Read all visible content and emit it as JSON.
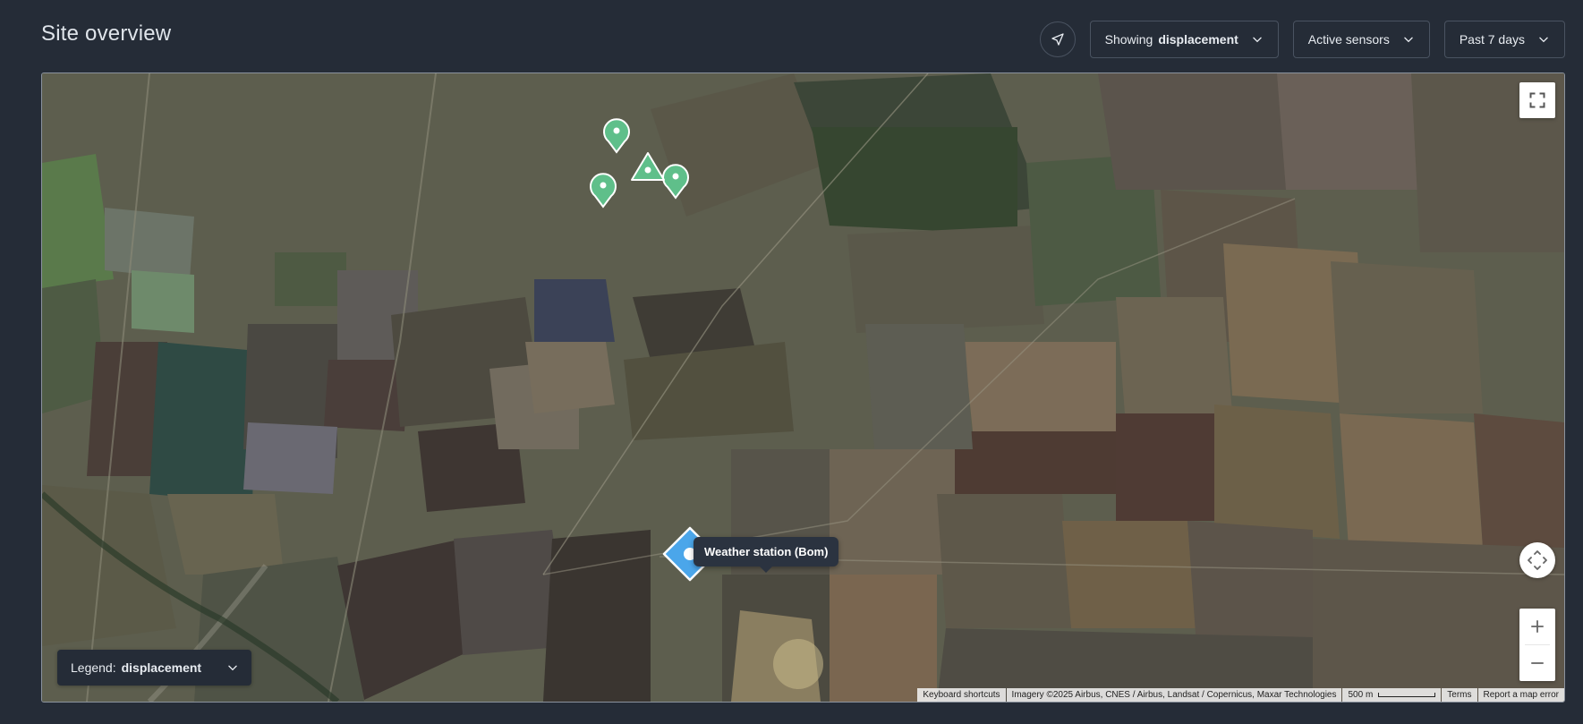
{
  "header": {
    "title": "Site overview"
  },
  "toolbar": {
    "location_icon": "navigation-arrow-icon",
    "display_filter": {
      "prefix": "Showing",
      "value": "displacement"
    },
    "sensor_filter": {
      "label": "Active sensors"
    },
    "time_filter": {
      "label": "Past 7 days"
    }
  },
  "map": {
    "controls": {
      "fullscreen_icon": "fullscreen-icon",
      "pan_icon": "pan-arrows-icon",
      "zoom_in_icon": "plus-icon",
      "zoom_out_icon": "minus-icon"
    },
    "legend": {
      "prefix": "Legend:",
      "value": "displacement"
    },
    "tooltip": "Weather station (Bom)",
    "markers": [
      {
        "type": "sensor-pin",
        "color": "#5fbf8a"
      },
      {
        "type": "sensor-pin",
        "color": "#5fbf8a"
      },
      {
        "type": "sensor-pin",
        "color": "#5fbf8a"
      },
      {
        "type": "sensor-triangle",
        "color": "#5fbf8a"
      },
      {
        "type": "weather-station-diamond",
        "color": "#4ba6ea"
      }
    ],
    "attribution": {
      "keyboard": "Keyboard shortcuts",
      "imagery": "Imagery ©2025 Airbus, CNES / Airbus, Landsat / Copernicus, Maxar Technologies",
      "scale": "500 m",
      "terms": "Terms",
      "report": "Report a map error"
    }
  },
  "colors": {
    "background": "#252c37",
    "sensor_green": "#5fbf8a",
    "weather_blue": "#4ba6ea"
  }
}
